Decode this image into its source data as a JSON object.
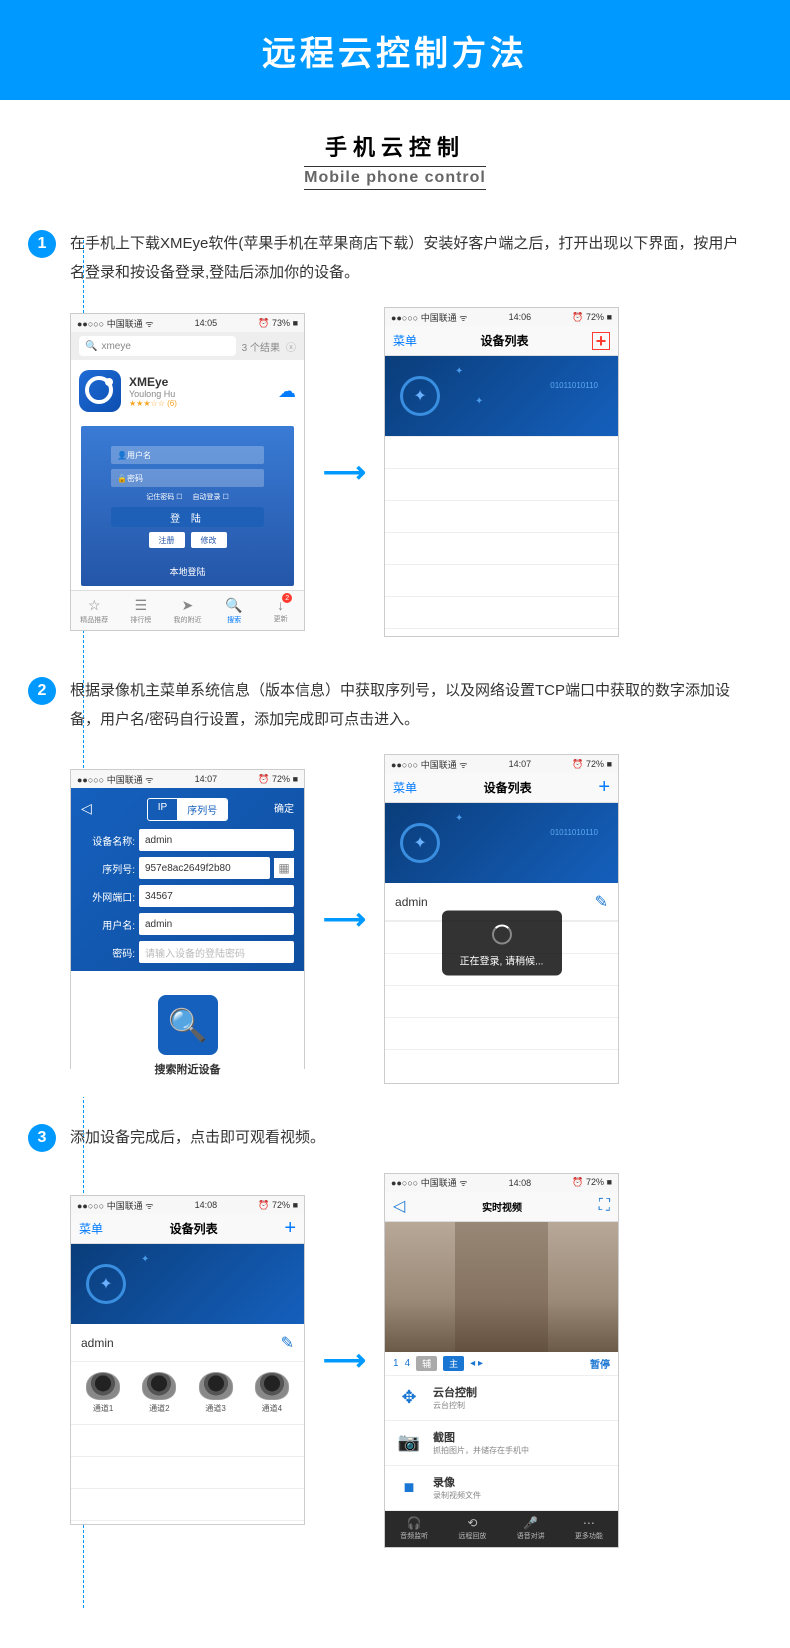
{
  "banner": "远程云控制方法",
  "subtitle_cn": "手机云控制",
  "subtitle_en": "Mobile phone control",
  "steps": {
    "s1": {
      "num": "1",
      "text": "在手机上下载XMEye软件(苹果手机在苹果商店下载）安装好客户端之后，打开出现以下界面，按用户名登录和按设备登录,登陆后添加你的设备。"
    },
    "s2": {
      "num": "2",
      "text": "根据录像机主菜单系统信息（版本信息）中获取序列号，以及网络设置TCP端口中获取的数字添加设备，用户名/密码自行设置，添加完成即可点击进入。"
    },
    "s3": {
      "num": "3",
      "text": "添加设备完成后，点击即可观看视频。"
    }
  },
  "status": {
    "carrier": "中国联通",
    "sig": "●●○○○",
    "wifi": "ᯤ",
    "alarm": "⏰",
    "t1": "14:05",
    "t2": "14:06",
    "t3": "14:07",
    "t4": "14:08",
    "bat1": "73%",
    "bat2": "72%",
    "baticon": "■"
  },
  "appstore": {
    "query": "xmeye",
    "results": "3 个结果",
    "clear": "ⓧ",
    "app_name": "XMEye",
    "dev": "Youlong Hu",
    "rating": "★★★☆☆ (6)",
    "dl": "☁",
    "login_user": "用户名",
    "login_pwd": "密码",
    "remember": "记住密码 ☐",
    "auto": "自动登录 ☐",
    "login_btn": "登  陆",
    "register": "注册",
    "modify": "修改",
    "local": "本地登陆",
    "tabs": {
      "t1": "精品推荐",
      "t2": "排行榜",
      "t3": "我的附近",
      "t4": "搜索",
      "t5": "更新"
    }
  },
  "devlist": {
    "menu": "菜单",
    "title": "设备列表",
    "add": "+"
  },
  "addform": {
    "back": "◁",
    "ok": "确定",
    "seg_ip": "IP",
    "seg_sn": "序列号",
    "f_name_l": "设备名称:",
    "f_name_v": "admin",
    "f_sn_l": "序列号:",
    "f_sn_v": "957e8ac2649f2b80",
    "f_port_l": "外网端口:",
    "f_port_v": "34567",
    "f_user_l": "用户名:",
    "f_user_v": "admin",
    "f_pwd_l": "密码:",
    "f_pwd_v": "请输入设备的登陆密码",
    "search_btn": "搜索附近设备",
    "qr": "▦"
  },
  "logging": {
    "device": "admin",
    "toast": "正在登录, 请稍候...",
    "edit": "✎"
  },
  "channels": {
    "device": "admin",
    "c1": "通道1",
    "c2": "通道2",
    "c3": "通道3",
    "c4": "通道4"
  },
  "live": {
    "back": "◁",
    "title": "实时视频",
    "full": "⛶",
    "n1": "1",
    "n4": "4",
    "aux": "辅",
    "main": "主",
    "pause": "暂停",
    "arrows": "◂ ▸",
    "opt1": "云台控制",
    "opt1s": "云台控制",
    "opt2": "截图",
    "opt2s": "抓拍图片，并储存在手机中",
    "opt3": "录像",
    "opt3s": "录制视频文件",
    "ft1": "音频监听",
    "ft2": "远程回放",
    "ft3": "语音对讲",
    "ft4": "更多功能"
  }
}
